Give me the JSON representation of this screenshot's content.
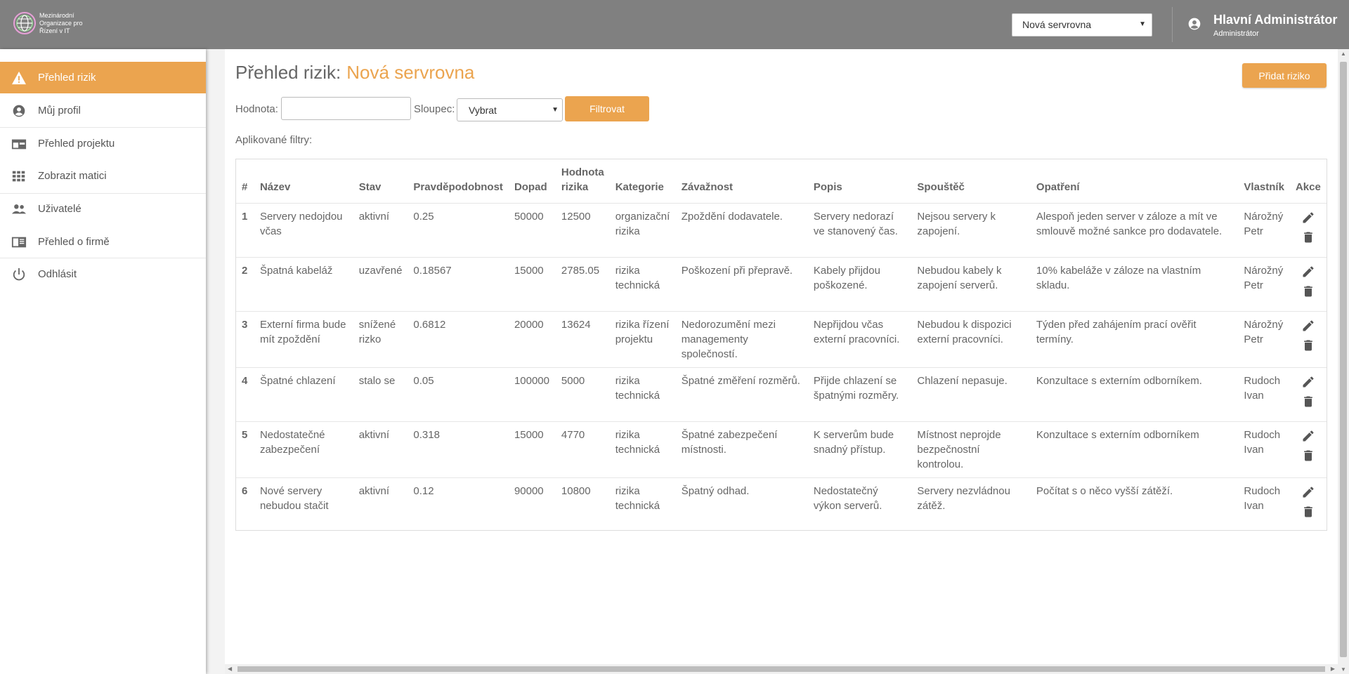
{
  "header": {
    "logo_text": "Mezinárodní Organizace pro Řízení v IT",
    "project_select_value": "Nová servrovna",
    "user_name": "Hlavní Administrátor",
    "user_role": "Administrátor"
  },
  "sidebar": {
    "items": [
      {
        "label": "Přehled rizik",
        "icon": "warning-icon",
        "active": true
      },
      {
        "label": "Můj profil",
        "icon": "account-circle-icon"
      },
      {
        "label": "Přehled projektu",
        "icon": "card-icon"
      },
      {
        "label": "Zobrazit matici",
        "icon": "grid-icon"
      },
      {
        "label": "Uživatelé",
        "icon": "people-icon"
      },
      {
        "label": "Přehled o firmě",
        "icon": "book-icon"
      },
      {
        "label": "Odhlásit",
        "icon": "power-icon"
      }
    ]
  },
  "main": {
    "title": "Přehled rizik:",
    "project_name": "Nová servrovna",
    "add_button": "Přidat riziko",
    "filter": {
      "value_label": "Hodnota:",
      "value_input": "",
      "column_label": "Sloupec:",
      "column_select": "Vybrat",
      "filter_button": "Filtrovat",
      "applied_label": "Aplikované filtry:"
    }
  },
  "table": {
    "headers": [
      "#",
      "Název",
      "Stav",
      "Pravděpodobnost",
      "Dopad",
      "Hodnota rizika",
      "Kategorie",
      "Závažnost",
      "Popis",
      "Spouštěč",
      "Opatření",
      "Vlastník",
      "Akce"
    ],
    "rows": [
      [
        "1",
        "Servery nedojdou včas",
        "aktivní",
        "0.25",
        "50000",
        "12500",
        "organizační rizika",
        "Zpoždění dodavatele.",
        "Servery nedorazí ve stanovený čas.",
        "Nejsou servery k zapojení.",
        "Alespoň jeden server v záloze a mít ve smlouvě možné sankce pro dodavatele.",
        "Nárožný Petr"
      ],
      [
        "2",
        "Špatná kabeláž",
        "uzavřené",
        "0.18567",
        "15000",
        "2785.05",
        "rizika technická",
        "Poškození při přepravě.",
        "Kabely přijdou poškozené.",
        "Nebudou kabely k zapojení serverů.",
        "10% kabeláže v záloze na vlastním skladu.",
        "Nárožný Petr"
      ],
      [
        "3",
        "Externí firma bude mít zpoždění",
        "snížené rizko",
        "0.6812",
        "20000",
        "13624",
        "rizika řízení projektu",
        "Nedorozumění mezi managementy společností.",
        "Nepřijdou včas externí pracovníci.",
        "Nebudou k dispozici externí pracovníci.",
        "Týden před zahájením prací ověřit termíny.",
        "Nárožný Petr"
      ],
      [
        "4",
        "Špatné chlazení",
        "stalo se",
        "0.05",
        "100000",
        "5000",
        "rizika technická",
        "Špatné změření rozměrů.",
        "Přijde chlazení se špatnými rozměry.",
        "Chlazení nepasuje.",
        "Konzultace s externím odborníkem.",
        "Rudoch Ivan"
      ],
      [
        "5",
        "Nedostatečné zabezpečení",
        "aktivní",
        "0.318",
        "15000",
        "4770",
        "rizika technická",
        "Špatné zabezpečení místnosti.",
        "K serverům bude snadný přístup.",
        "Místnost neprojde bezpečnostní kontrolou.",
        "Konzultace s externím odborníkem",
        "Rudoch Ivan"
      ],
      [
        "6",
        "Nové servery nebudou stačit",
        "aktivní",
        "0.12",
        "90000",
        "10800",
        "rizika technická",
        "Špatný odhad.",
        "Nedostatečný výkon serverů.",
        "Servery nezvládnou zátěž.",
        "Počítat s o něco vyšší zátěží.",
        "Rudoch Ivan"
      ]
    ]
  },
  "colors": {
    "accent": "#eba44f",
    "header": "#808080"
  }
}
